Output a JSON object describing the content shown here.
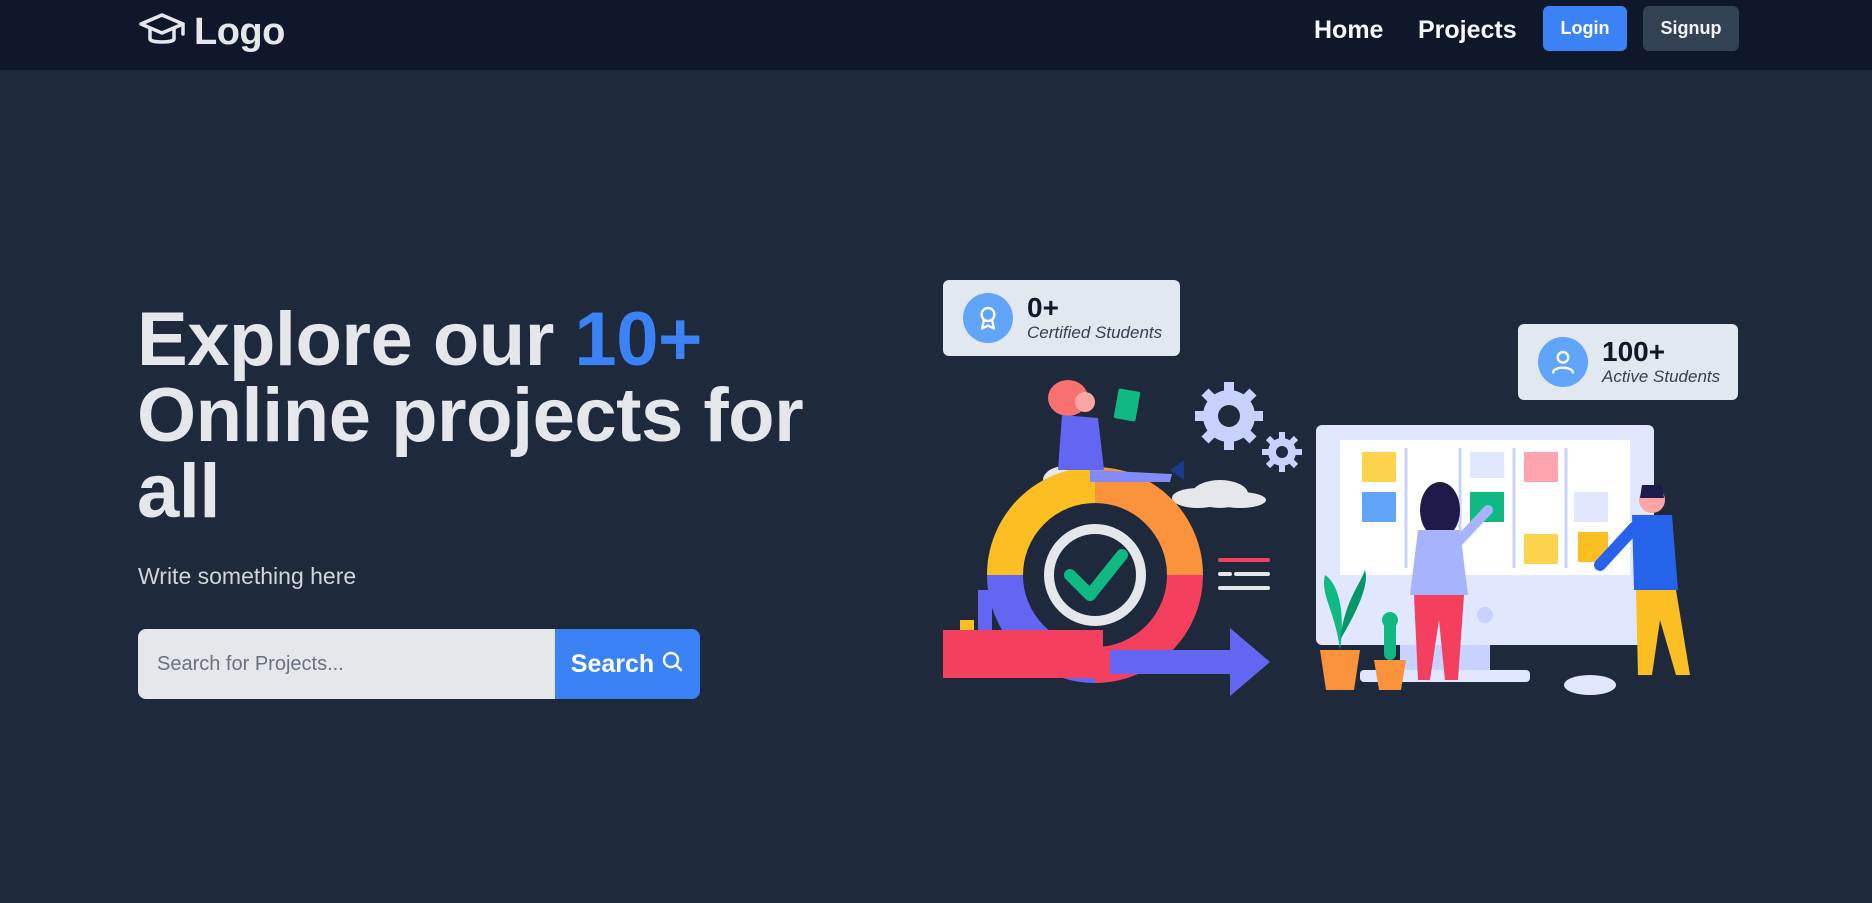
{
  "navbar": {
    "logo_text": "Logo",
    "logo_icon": "graduation-cap-icon",
    "links": [
      {
        "label": "Home"
      },
      {
        "label": "Projects"
      }
    ],
    "login_label": "Login",
    "signup_label": "Signup"
  },
  "hero": {
    "title_part1": "Explore our ",
    "title_accent": "10+",
    "title_part2": " Online projects for all",
    "subtitle": "Write something here",
    "search": {
      "placeholder": "Search for Projects...",
      "button_label": "Search",
      "button_icon": "search-icon"
    }
  },
  "stats": [
    {
      "value": "0+",
      "label": "Certified Students",
      "icon": "award-ribbon-icon"
    },
    {
      "value": "100+",
      "label": "Active Students",
      "icon": "user-icon"
    }
  ],
  "colors": {
    "background": "#1e293b",
    "navbar": "#0f172a",
    "accent": "#3b82f6",
    "card": "#e2e8f0",
    "signup": "#334155"
  }
}
